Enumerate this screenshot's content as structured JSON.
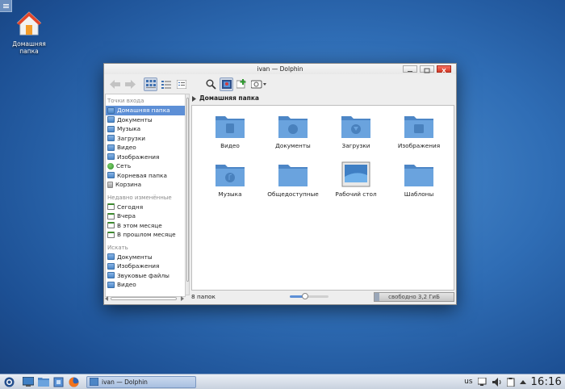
{
  "desktop": {
    "icon_label_line1": "Домашняя",
    "icon_label_line2": "папка"
  },
  "window": {
    "title": "ivan — Dolphin"
  },
  "sidebar": {
    "places_header": "Точки входа",
    "places": [
      {
        "label": "Домашняя папка",
        "icon": "home-folder-icon",
        "selected": true
      },
      {
        "label": "Документы",
        "icon": "folder-icon"
      },
      {
        "label": "Музыка",
        "icon": "folder-icon"
      },
      {
        "label": "Загрузки",
        "icon": "folder-icon"
      },
      {
        "label": "Видео",
        "icon": "folder-icon"
      },
      {
        "label": "Изображения",
        "icon": "folder-icon"
      },
      {
        "label": "Сеть",
        "icon": "network-icon"
      },
      {
        "label": "Корневая папка",
        "icon": "folder-icon"
      },
      {
        "label": "Корзина",
        "icon": "trash-icon"
      }
    ],
    "recent_header": "Недавно изменённые",
    "recent": [
      {
        "label": "Сегодня",
        "icon": "calendar-icon"
      },
      {
        "label": "Вчера",
        "icon": "calendar-icon"
      },
      {
        "label": "В этом месяце",
        "icon": "calendar-icon"
      },
      {
        "label": "В прошлом месяце",
        "icon": "calendar-icon"
      }
    ],
    "search_header": "Искать",
    "search": [
      {
        "label": "Документы",
        "icon": "folder-icon"
      },
      {
        "label": "Изображения",
        "icon": "folder-icon"
      },
      {
        "label": "Звуковые файлы",
        "icon": "folder-icon"
      },
      {
        "label": "Видео",
        "icon": "folder-icon"
      }
    ]
  },
  "breadcrumb": {
    "current": "Домашняя папка"
  },
  "files": [
    {
      "label": "Видео",
      "icon": "video-folder-icon"
    },
    {
      "label": "Документы",
      "icon": "documents-folder-icon"
    },
    {
      "label": "Загрузки",
      "icon": "downloads-folder-icon"
    },
    {
      "label": "Изображения",
      "icon": "pictures-folder-icon"
    },
    {
      "label": "Музыка",
      "icon": "music-folder-icon"
    },
    {
      "label": "Общедоступные",
      "icon": "folder-icon"
    },
    {
      "label": "Рабочий стол",
      "icon": "desktop-folder-icon"
    },
    {
      "label": "Шаблоны",
      "icon": "folder-icon"
    }
  ],
  "status": {
    "count": "8 папок",
    "free_space": "свободно 3,2 ГиБ",
    "zoom_fraction": 0.4,
    "used_fraction": 0.06
  },
  "taskbar": {
    "task_label": "ivan — Dolphin",
    "keyboard_layout": "us",
    "clock": "16:16"
  },
  "colors": {
    "accent": "#5d8fd6",
    "folder": "#5a95d4"
  }
}
